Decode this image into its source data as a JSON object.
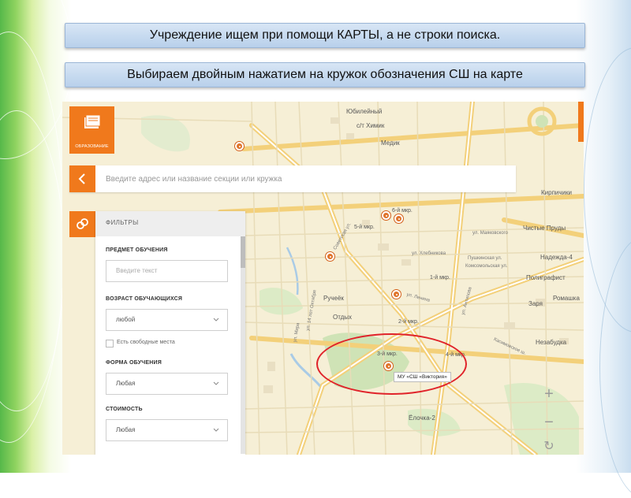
{
  "slide": {
    "banner_1": "Учреждение ищем при помощи КАРТЫ, а не строки поиска.",
    "banner_2": "Выбираем двойным нажатием на кружок обозначения СШ на карте"
  },
  "map_ui": {
    "category_tile": {
      "caption": "ОБРАЗОВАНИЕ",
      "icon": "book-icon"
    },
    "search": {
      "placeholder": "Введите адрес или название секции или кружка",
      "value": ""
    },
    "filters": {
      "title": "ФИЛЬТРЫ",
      "subject_label": "ПРЕДМЕТ ОБУЧЕНИЯ",
      "subject_placeholder": "Введите текст",
      "age_label": "ВОЗРАСТ ОБУЧАЮЩИХСЯ",
      "age_value": "любой",
      "free_places_label": "Есть свободные места",
      "form_label": "ФОРМА ОБУЧЕНИЯ",
      "form_value": "Любая",
      "cost_label": "СТОИМОСТЬ",
      "cost_value": "Любая"
    },
    "selected_tooltip": "МУ «СШ «Виктория»",
    "zoom_in": "+",
    "zoom_out": "−",
    "reset": "↻"
  },
  "map_labels": [
    "Юбилейный",
    "с/т Химик",
    "Медик",
    "6-й мкр.",
    "5-й мкр.",
    "Кирпичики",
    "Чистые Пруды",
    "Надежда-4",
    "Полиграфист",
    "Ромашка",
    "Заря",
    "1-й мкр.",
    "Ручеёк",
    "Отдых",
    "2-й мкр.",
    "3-й мкр.",
    "4-й мкр.",
    "Незабудка",
    "Ёлочка-2"
  ],
  "street_labels": [
    "ул. Маяковского",
    "ул. Хлебникова",
    "Пушкинская ул.",
    "Комсомольская ул.",
    "ул. Ленина",
    "Советская ул.",
    "ул. Антипова",
    "Касимовское ш.",
    "ул. Мира",
    "ул. 14 лет Октября"
  ],
  "colors": {
    "accent_orange": "#f0791c",
    "highlight_red": "#e0232a"
  }
}
